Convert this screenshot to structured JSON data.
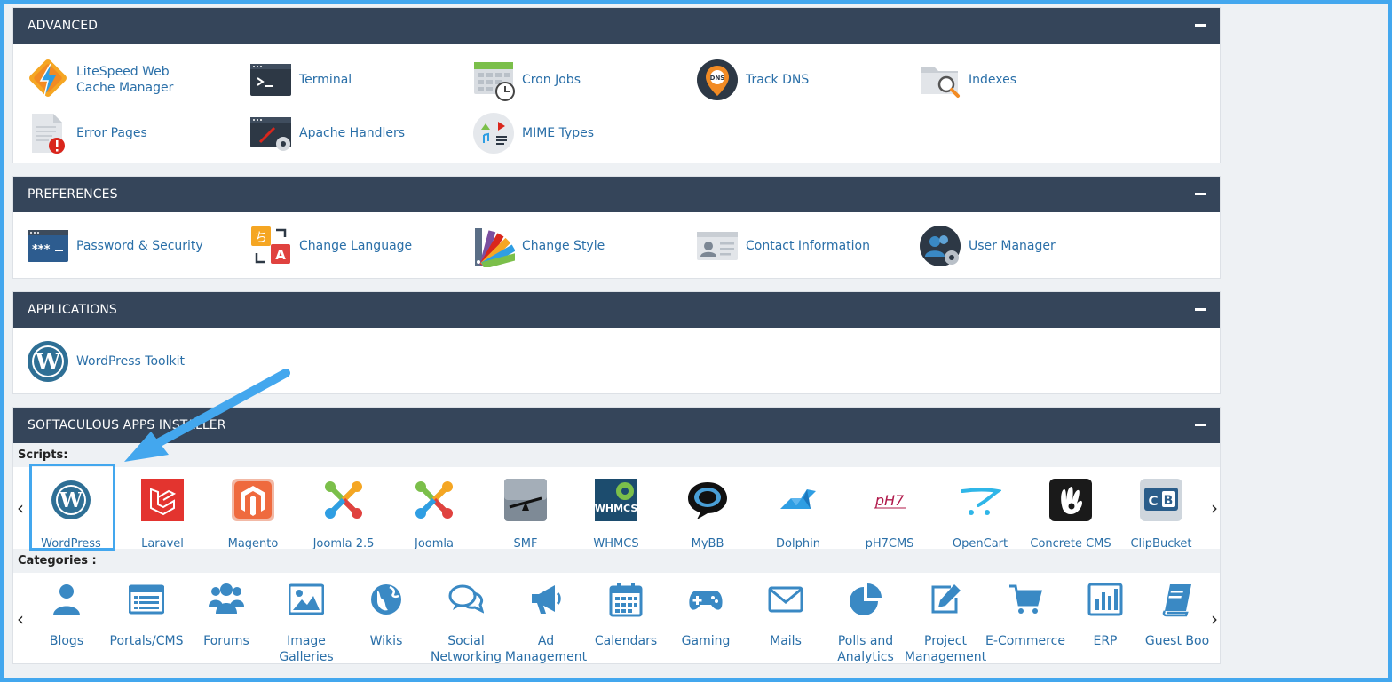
{
  "advanced": {
    "title": "ADVANCED",
    "items": [
      {
        "label": "LiteSpeed Web Cache Manager",
        "icon": "litespeed-icon"
      },
      {
        "label": "Terminal",
        "icon": "terminal-icon"
      },
      {
        "label": "Cron Jobs",
        "icon": "cron-calendar-icon"
      },
      {
        "label": "Track DNS",
        "icon": "dns-pin-icon"
      },
      {
        "label": "Indexes",
        "icon": "folder-search-icon"
      },
      {
        "label": "Error Pages",
        "icon": "error-page-icon"
      },
      {
        "label": "Apache Handlers",
        "icon": "apache-handlers-icon"
      },
      {
        "label": "MIME Types",
        "icon": "mime-types-icon"
      }
    ]
  },
  "preferences": {
    "title": "PREFERENCES",
    "items": [
      {
        "label": "Password & Security",
        "icon": "password-icon"
      },
      {
        "label": "Change Language",
        "icon": "language-icon"
      },
      {
        "label": "Change Style",
        "icon": "style-palette-icon"
      },
      {
        "label": "Contact Information",
        "icon": "contact-card-icon"
      },
      {
        "label": "User Manager",
        "icon": "user-manager-icon"
      }
    ]
  },
  "applications": {
    "title": "APPLICATIONS",
    "items": [
      {
        "label": "WordPress Toolkit",
        "icon": "wordpress-icon"
      }
    ]
  },
  "softaculous": {
    "title": "SOFTACULOUS APPS INSTALLER",
    "scripts_label": "Scripts:",
    "categories_label": "Categories :",
    "prev": "‹",
    "next": "›",
    "scripts": [
      {
        "label": "WordPress",
        "icon": "wordpress-icon"
      },
      {
        "label": "Laravel",
        "icon": "laravel-icon"
      },
      {
        "label": "Magento",
        "icon": "magento-icon"
      },
      {
        "label": "Joomla 2.5",
        "icon": "joomla-icon"
      },
      {
        "label": "Joomla",
        "icon": "joomla-icon"
      },
      {
        "label": "SMF",
        "icon": "smf-icon"
      },
      {
        "label": "WHMCS",
        "icon": "whmcs-icon"
      },
      {
        "label": "MyBB",
        "icon": "mybb-icon"
      },
      {
        "label": "Dolphin",
        "icon": "dolphin-icon"
      },
      {
        "label": "pH7CMS",
        "icon": "ph7cms-icon"
      },
      {
        "label": "OpenCart",
        "icon": "opencart-icon"
      },
      {
        "label": "Concrete CMS",
        "icon": "concrete-cms-icon"
      },
      {
        "label": "ClipBucket",
        "icon": "clipbucket-icon"
      }
    ],
    "categories": [
      {
        "label": "Blogs",
        "label2": "",
        "icon": "user-icon"
      },
      {
        "label": "Portals/CMS",
        "label2": "",
        "icon": "list-window-icon"
      },
      {
        "label": "Forums",
        "label2": "",
        "icon": "users-group-icon"
      },
      {
        "label": "Image",
        "label2": "Galleries",
        "icon": "image-icon"
      },
      {
        "label": "Wikis",
        "label2": "",
        "icon": "globe-icon"
      },
      {
        "label": "Social",
        "label2": "Networking",
        "icon": "chat-bubbles-icon"
      },
      {
        "label": "Ad",
        "label2": "Management",
        "icon": "megaphone-icon"
      },
      {
        "label": "Calendars",
        "label2": "",
        "icon": "calendar-icon"
      },
      {
        "label": "Gaming",
        "label2": "",
        "icon": "gamepad-icon"
      },
      {
        "label": "Mails",
        "label2": "",
        "icon": "envelope-icon"
      },
      {
        "label": "Polls and",
        "label2": "Analytics",
        "icon": "pie-chart-icon"
      },
      {
        "label": "Project",
        "label2": "Management",
        "icon": "edit-icon"
      },
      {
        "label": "E-Commerce",
        "label2": "",
        "icon": "cart-icon"
      },
      {
        "label": "ERP",
        "label2": "",
        "icon": "bar-chart-icon"
      },
      {
        "label": "Guest Boo",
        "label2": "",
        "icon": "book-icon"
      }
    ]
  },
  "colors": {
    "header_bg": "#35455a",
    "link": "#2a6fa8",
    "category_icon": "#3a89c4",
    "highlight": "#43a7ee"
  }
}
